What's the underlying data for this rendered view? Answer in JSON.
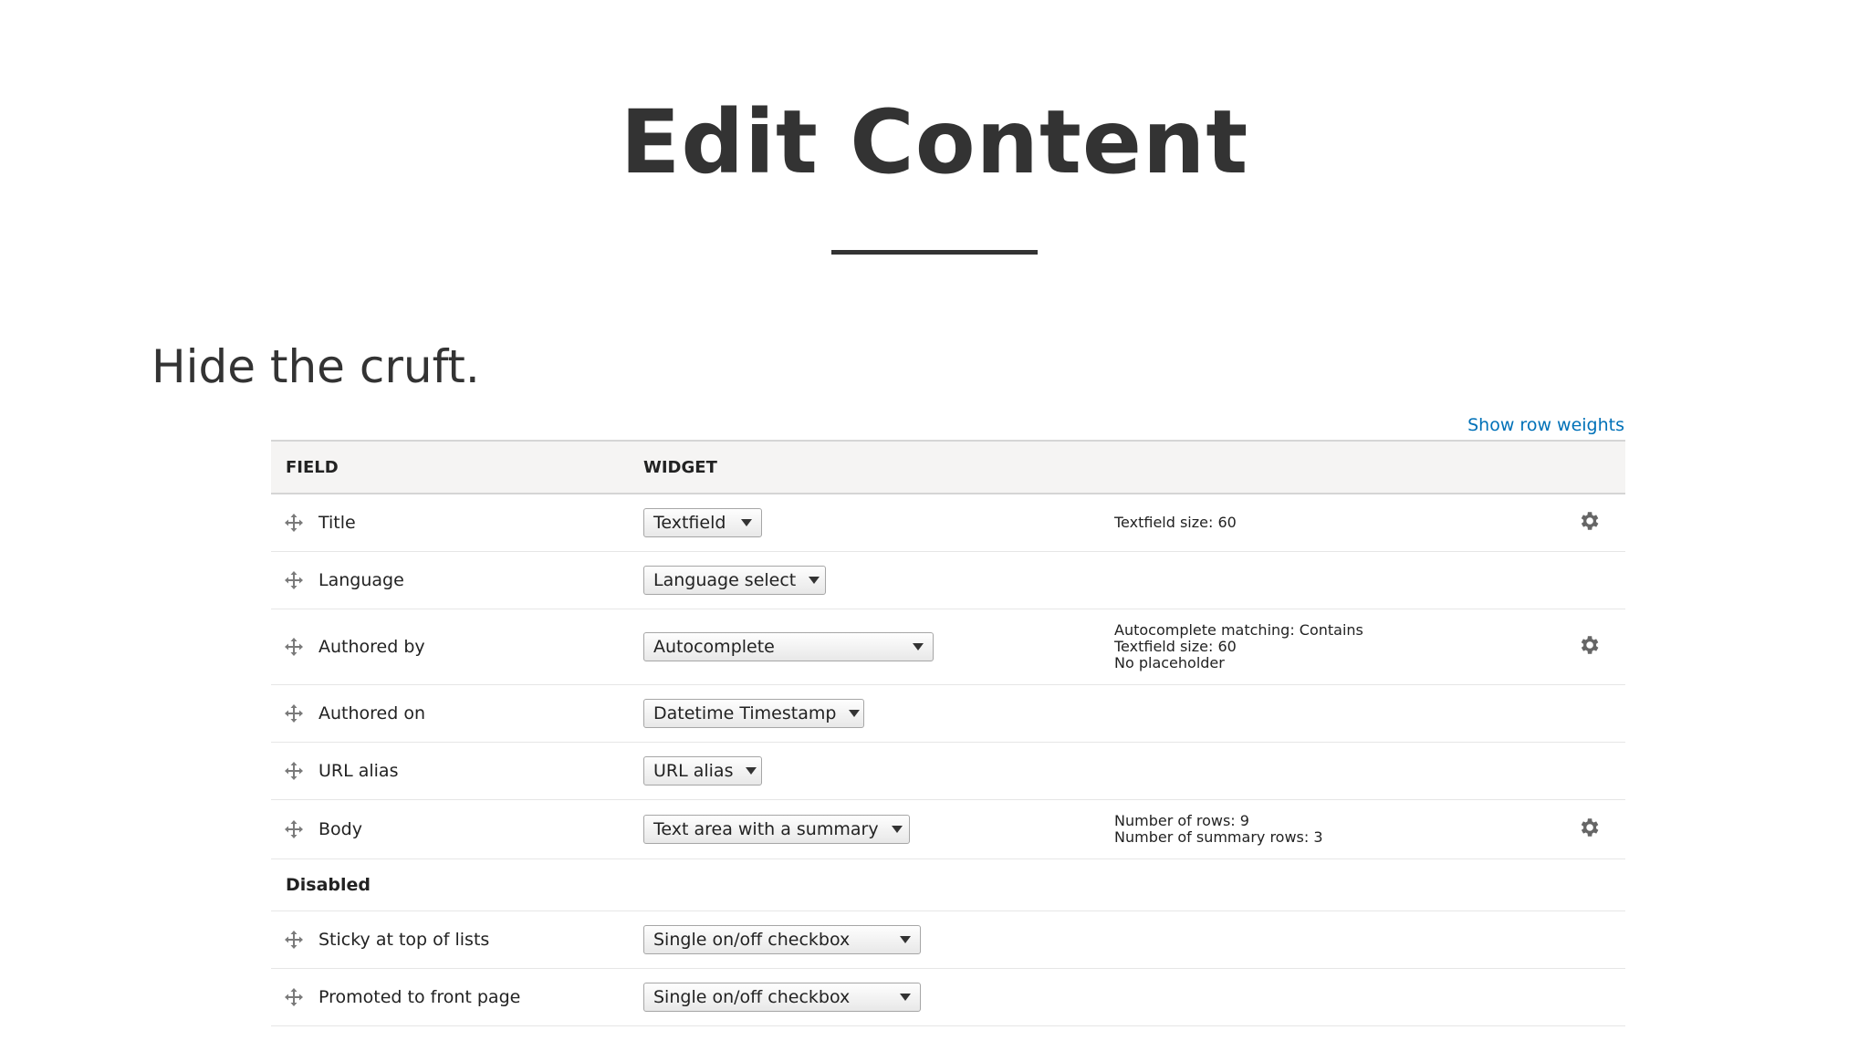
{
  "slide": {
    "title": "Edit Content",
    "subtitle": "Hide the cruft."
  },
  "table": {
    "show_row_weights_label": "Show row weights",
    "headers": {
      "field": "FIELD",
      "widget": "WIDGET"
    },
    "rows": [
      {
        "field": "Title",
        "widget": "Textfield",
        "summary": [
          "Textfield size: 60"
        ],
        "has_settings": true
      },
      {
        "field": "Language",
        "widget": "Language select",
        "summary": [],
        "has_settings": false
      },
      {
        "field": "Authored by",
        "widget": "Autocomplete",
        "summary": [
          "Autocomplete matching: Contains",
          "Textfield size: 60",
          "No placeholder"
        ],
        "has_settings": true
      },
      {
        "field": "Authored on",
        "widget": "Datetime Timestamp",
        "summary": [],
        "has_settings": false
      },
      {
        "field": "URL alias",
        "widget": "URL alias",
        "summary": [],
        "has_settings": false
      },
      {
        "field": "Body",
        "widget": "Text area with a summary",
        "summary": [
          "Number of rows: 9",
          "Number of summary rows: 3"
        ],
        "has_settings": true
      }
    ],
    "disabled_region_label": "Disabled",
    "disabled_rows": [
      {
        "field": "Sticky at top of lists",
        "widget": "Single on/off checkbox"
      },
      {
        "field": "Promoted to front page",
        "widget": "Single on/off checkbox"
      }
    ]
  },
  "icons": {
    "drag": "drag-handle-icon",
    "settings": "gear-icon",
    "dropdown": "chevron-down-icon"
  },
  "colors": {
    "heading": "#333333",
    "link": "#0071b8",
    "table_header_bg": "#f5f4f3"
  }
}
